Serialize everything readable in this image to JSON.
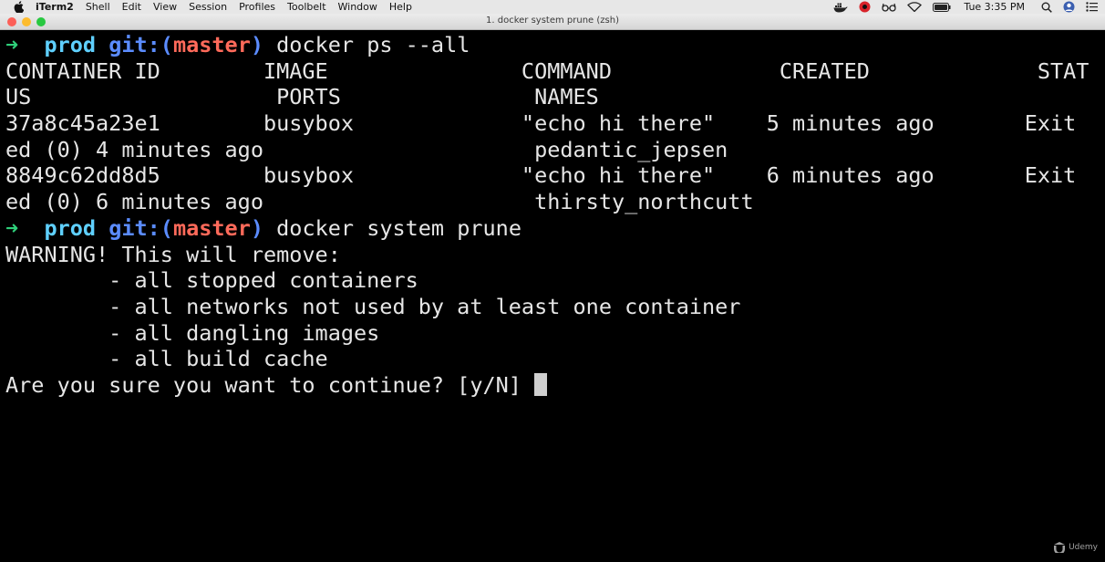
{
  "menubar": {
    "app_name": "iTerm2",
    "items": [
      "Shell",
      "Edit",
      "View",
      "Session",
      "Profiles",
      "Toolbelt",
      "Window",
      "Help"
    ],
    "clock": "Tue 3:35 PM"
  },
  "window": {
    "title": "1. docker system prune (zsh)"
  },
  "terminal": {
    "prompt": {
      "arrow": "➜",
      "dir": "prod",
      "git": "git:(",
      "branch": "master",
      "git_close": ")"
    },
    "command1": "docker ps --all",
    "ps_output": [
      "CONTAINER ID        IMAGE               COMMAND             CREATED             STAT",
      "US                   PORTS               NAMES",
      "37a8c45a23e1        busybox             \"echo hi there\"    5 minutes ago       Exit",
      "ed (0) 4 minutes ago                     pedantic_jepsen",
      "8849c62dd8d5        busybox             \"echo hi there\"    6 minutes ago       Exit",
      "ed (0) 6 minutes ago                     thirsty_northcutt"
    ],
    "command2": "docker system prune",
    "prune_output": [
      "WARNING! This will remove:",
      "        - all stopped containers",
      "        - all networks not used by at least one container",
      "        - all dangling images",
      "        - all build cache"
    ],
    "confirm_prompt": "Are you sure you want to continue? [y/N] "
  },
  "watermark": {
    "text": "Udemy"
  }
}
